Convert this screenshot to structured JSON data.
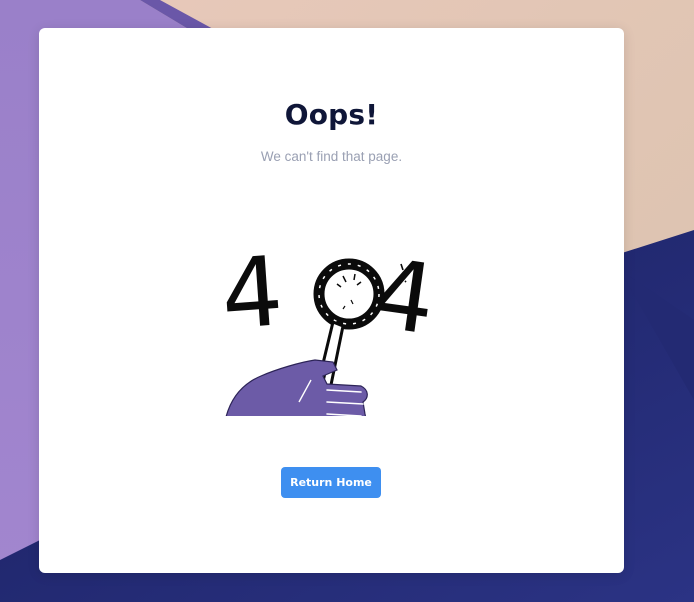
{
  "page": {
    "title": "Oops!",
    "subtitle": "We can't find that page.",
    "error_code": "404",
    "return_button_label": "Return Home"
  },
  "colors": {
    "title": "#0f1638",
    "subtitle": "#9aa0b3",
    "button": "#3e8ff0",
    "hand": "#6c5ba7",
    "background_purple": "#9b82cb",
    "background_peach": "#e3c7b6",
    "background_navy": "#1e2466"
  },
  "icons": {
    "illustration": "magnifier-404-icon"
  }
}
